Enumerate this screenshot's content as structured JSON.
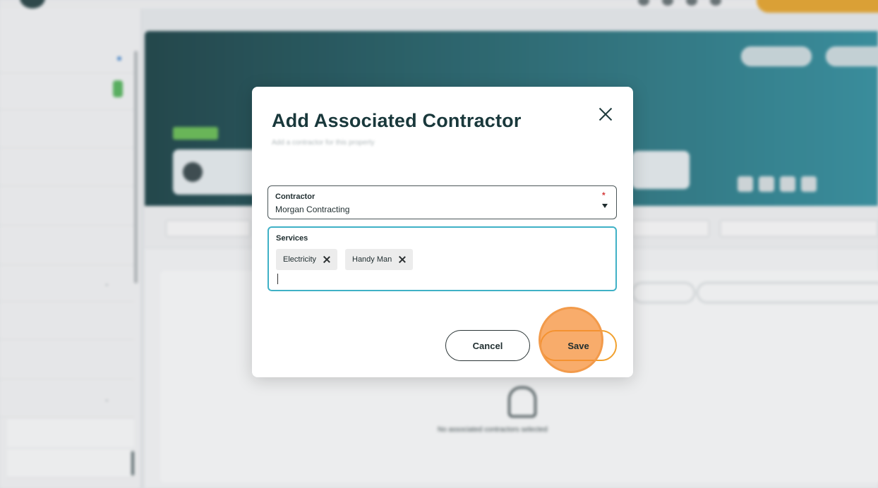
{
  "modal": {
    "title": "Add Associated Contractor",
    "subtitle": "Add a contractor for this property",
    "close_icon": "close-icon",
    "contractor": {
      "label": "Contractor",
      "required_mark": "*",
      "value": "Morgan Contracting",
      "caret_icon": "caret-down-icon"
    },
    "services": {
      "label": "Services",
      "chips": [
        {
          "label": "Electricity"
        },
        {
          "label": "Handy Man"
        }
      ],
      "input_value": ""
    },
    "actions": {
      "cancel_label": "Cancel",
      "save_label": "Save"
    }
  },
  "background": {
    "empty_state_text": "No associated contractors selected",
    "colors": {
      "accent": "#3fb1c6",
      "save_border": "#f1a02d",
      "click_highlight": "#f58c32",
      "hero_start": "#22484c",
      "hero_end": "#3a94a3"
    }
  }
}
